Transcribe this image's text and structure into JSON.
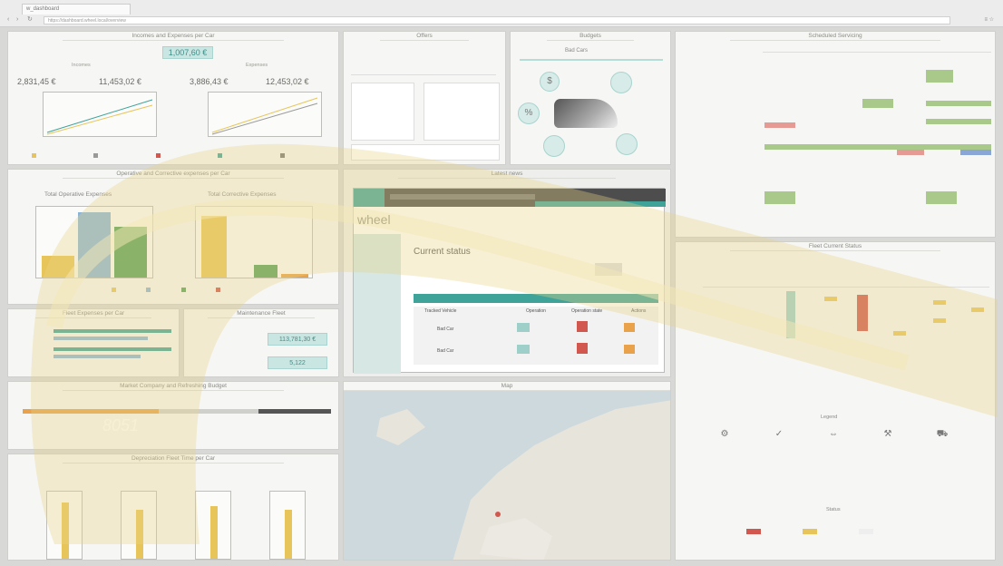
{
  "browser": {
    "tab_title": "w_dashboard",
    "address": "https://dashboard.wheel.local/overview"
  },
  "panels": {
    "incomes_expenses": {
      "title": "Incomes and Expenses per Car",
      "total": "1,007,60 €",
      "left_title": "Incomes",
      "right_title": "Expenses",
      "left_kpi": "2,831,45 €",
      "left_kpi2": "11,453,02 €",
      "right_kpi": "3,886,43 €",
      "right_kpi2": "12,453,02 €"
    },
    "offers": {
      "title": "Offers"
    },
    "budgets": {
      "title": "Budgets",
      "center_label": "Bad Cars"
    },
    "scheduled": {
      "title": "Scheduled Servicing"
    },
    "operative_costs": {
      "title": "Operative and Corrective expenses per Car",
      "left_chart": "Total Operative Expenses",
      "right_chart": "Total Corrective Expenses"
    },
    "latest_news": {
      "title": "Latest news"
    },
    "app_window": {
      "brand": "wheel",
      "section": "Current status",
      "row1": "Bad Car",
      "row2": "Bad Car",
      "col1": "Tracked Vehicle",
      "col2": "Operation",
      "col3": "Operation state",
      "col4": "Actions"
    },
    "fleet_status": {
      "title": "Fleet Current Status",
      "legend_title": "Legend",
      "status_title": "Status"
    },
    "fleet_expenses": {
      "title": "Fleet Expenses per Car"
    },
    "maintenance_fleet": {
      "title": "Maintenance Fleet",
      "value1": "113,781,30 €",
      "value2": "5,122"
    },
    "market_company": {
      "title": "Market Company and Refreshing Budget",
      "big_number": "8051"
    },
    "depreciation": {
      "title": "Depreciation Fleet Time per Car"
    },
    "map": {
      "title": "Map"
    }
  },
  "colors": {
    "teal": "#3fa39a",
    "yellow": "#e8c55a",
    "green": "#5aa05a",
    "blue": "#8ab4d8",
    "orange": "#e9a14a",
    "red": "#d2574f",
    "dark": "#4a4a4a"
  }
}
